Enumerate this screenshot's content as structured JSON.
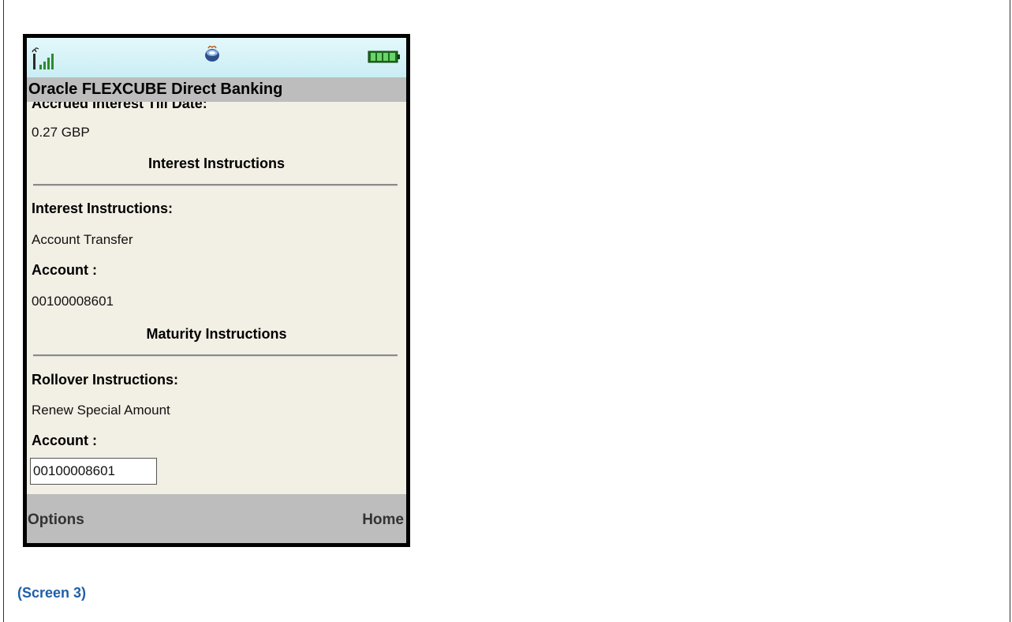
{
  "app": {
    "title": "Oracle FLEXCUBE Direct Banking"
  },
  "status_bar": {
    "signal_icon": "signal-strength-icon",
    "java_icon": "java-cup-icon",
    "battery_icon": "battery-icon"
  },
  "details": {
    "accrued_interest_label": "Accrued Interest Till Date:",
    "accrued_interest_value": "0.27 GBP",
    "interest_section_title": "Interest Instructions",
    "interest_instructions_label": "Interest Instructions:",
    "interest_instructions_value": "Account Transfer",
    "interest_account_label": "Account :",
    "interest_account_value": "00100008601",
    "maturity_section_title": "Maturity Instructions",
    "rollover_label": "Rollover Instructions:",
    "rollover_value": "Renew Special Amount",
    "maturity_account_label": "Account :",
    "maturity_account_value": "00100008601"
  },
  "softkeys": {
    "left": "Options",
    "right": "Home"
  },
  "caption": "(Screen 3)",
  "colors": {
    "caption": "#1f5fa8",
    "screen_bg": "#f2efe4",
    "bar_bg": "#bdbdbd"
  }
}
